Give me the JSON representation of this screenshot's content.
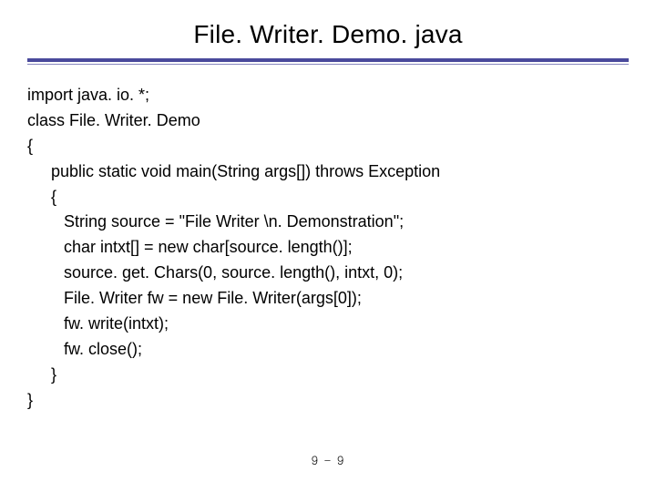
{
  "title": "File. Writer. Demo. java",
  "code": {
    "l01": "import java. io. *;",
    "l02": "class File. Writer. Demo",
    "l03": "{",
    "l04": "public static void main(String args[]) throws Exception",
    "l05": "{",
    "l06": "String source = \"File Writer \\n. Demonstration\";",
    "l07": "char intxt[] = new char[source. length()];",
    "l08": "source. get. Chars(0, source. length(), intxt, 0);",
    "l09": "File. Writer fw = new File. Writer(args[0]);",
    "l10": "fw. write(intxt);",
    "l11": "fw. close();",
    "l12": "}",
    "l13": "}"
  },
  "footer": "9 - 9"
}
